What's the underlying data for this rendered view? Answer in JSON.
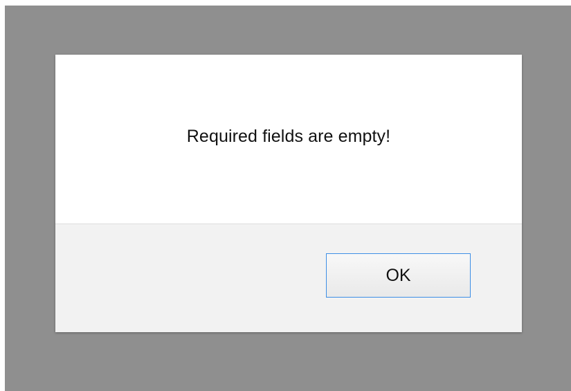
{
  "dialog": {
    "message": "Required fields are empty!",
    "ok_label": "OK"
  },
  "colors": {
    "backdrop": "#8f8f8f",
    "dialog_background": "#ffffff",
    "footer_background": "#f2f2f2",
    "button_border": "#3c8ee6"
  }
}
